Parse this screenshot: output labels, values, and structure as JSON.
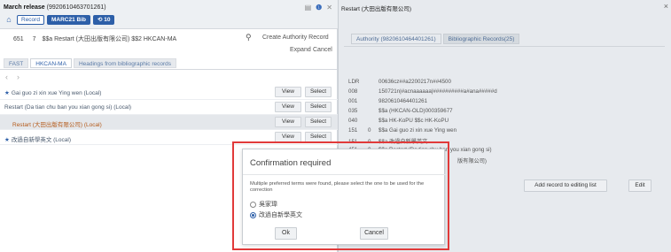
{
  "left": {
    "record_title": "March release",
    "record_id": "(9920610463701261)",
    "crumbs": {
      "record": "Record",
      "bib": "MARC21 Bib",
      "count": "10"
    },
    "field": {
      "tag": "651",
      "ind": "7",
      "text": "$$a Restart (大田出版有限公司) $$2 HKCAN-MA"
    },
    "actions": {
      "create": "Create Authority Record",
      "expand": "Expand",
      "cancel": "Cancel"
    },
    "tabs": [
      "FAST",
      "HKCAN-MA",
      "Headings from bibliographic records"
    ],
    "results": [
      {
        "label": "Gai guo zi xin xue Ying wen (Local)",
        "starred": true,
        "highlight": false,
        "orange": false
      },
      {
        "label": "Restart (Da tian chu ban you xian gong si) (Local)",
        "starred": false,
        "highlight": false,
        "orange": false
      },
      {
        "label": "Restart (大田出版有限公司) (Local)",
        "starred": false,
        "highlight": true,
        "orange": true
      },
      {
        "label": "改過自新學英文 (Local)",
        "starred": true,
        "highlight": false,
        "orange": false
      }
    ],
    "view_label": "View",
    "select_label": "Select"
  },
  "right": {
    "title": "Restart (大田出版有限公司)",
    "tabs": [
      "Authority (9820610464401261)",
      "Bibliographic Records(25)"
    ],
    "marc": [
      {
        "tag": "LDR",
        "ind": "",
        "val": "00636cz##a2200217n##4500"
      },
      {
        "tag": "008",
        "ind": "",
        "val": "150721n|#acnaaaaaa|##########a#ana#####d"
      },
      {
        "tag": "001",
        "ind": "",
        "val": "9820610464401261"
      },
      {
        "tag": "035",
        "ind": "",
        "val": "$$a (HKCAN-OLD)000359677"
      },
      {
        "tag": "040",
        "ind": "",
        "val": "$$a HK-KoPU $$c HK-KoPU"
      },
      {
        "tag": "151",
        "ind": "0",
        "val": "$$a Gai guo zi xin xue Ying wen"
      },
      {
        "tag": "151",
        "ind": "0",
        "val": "$$a 改過自新學英文"
      },
      {
        "tag": "451",
        "ind": "0",
        "val": "$$a Restart (Da tian chu ban you xian gong si)"
      },
      {
        "tag": "",
        "ind": "",
        "val": "版有限公司)"
      }
    ],
    "add_btn": "Add record to editing list",
    "edit_btn": "Edit"
  },
  "modal": {
    "title": "Confirmation required",
    "message": "Multiple preferred terms were found, please select the one to be used for the correction",
    "options": [
      {
        "label": "吳家瑋",
        "checked": false
      },
      {
        "label": "改過自新學英文",
        "checked": true
      }
    ],
    "ok": "Ok",
    "cancel": "Cancel"
  },
  "colors": {
    "accent": "#2d5fa8",
    "highlight_border": "#e13a3a",
    "orange_text": "#b45a1a"
  }
}
